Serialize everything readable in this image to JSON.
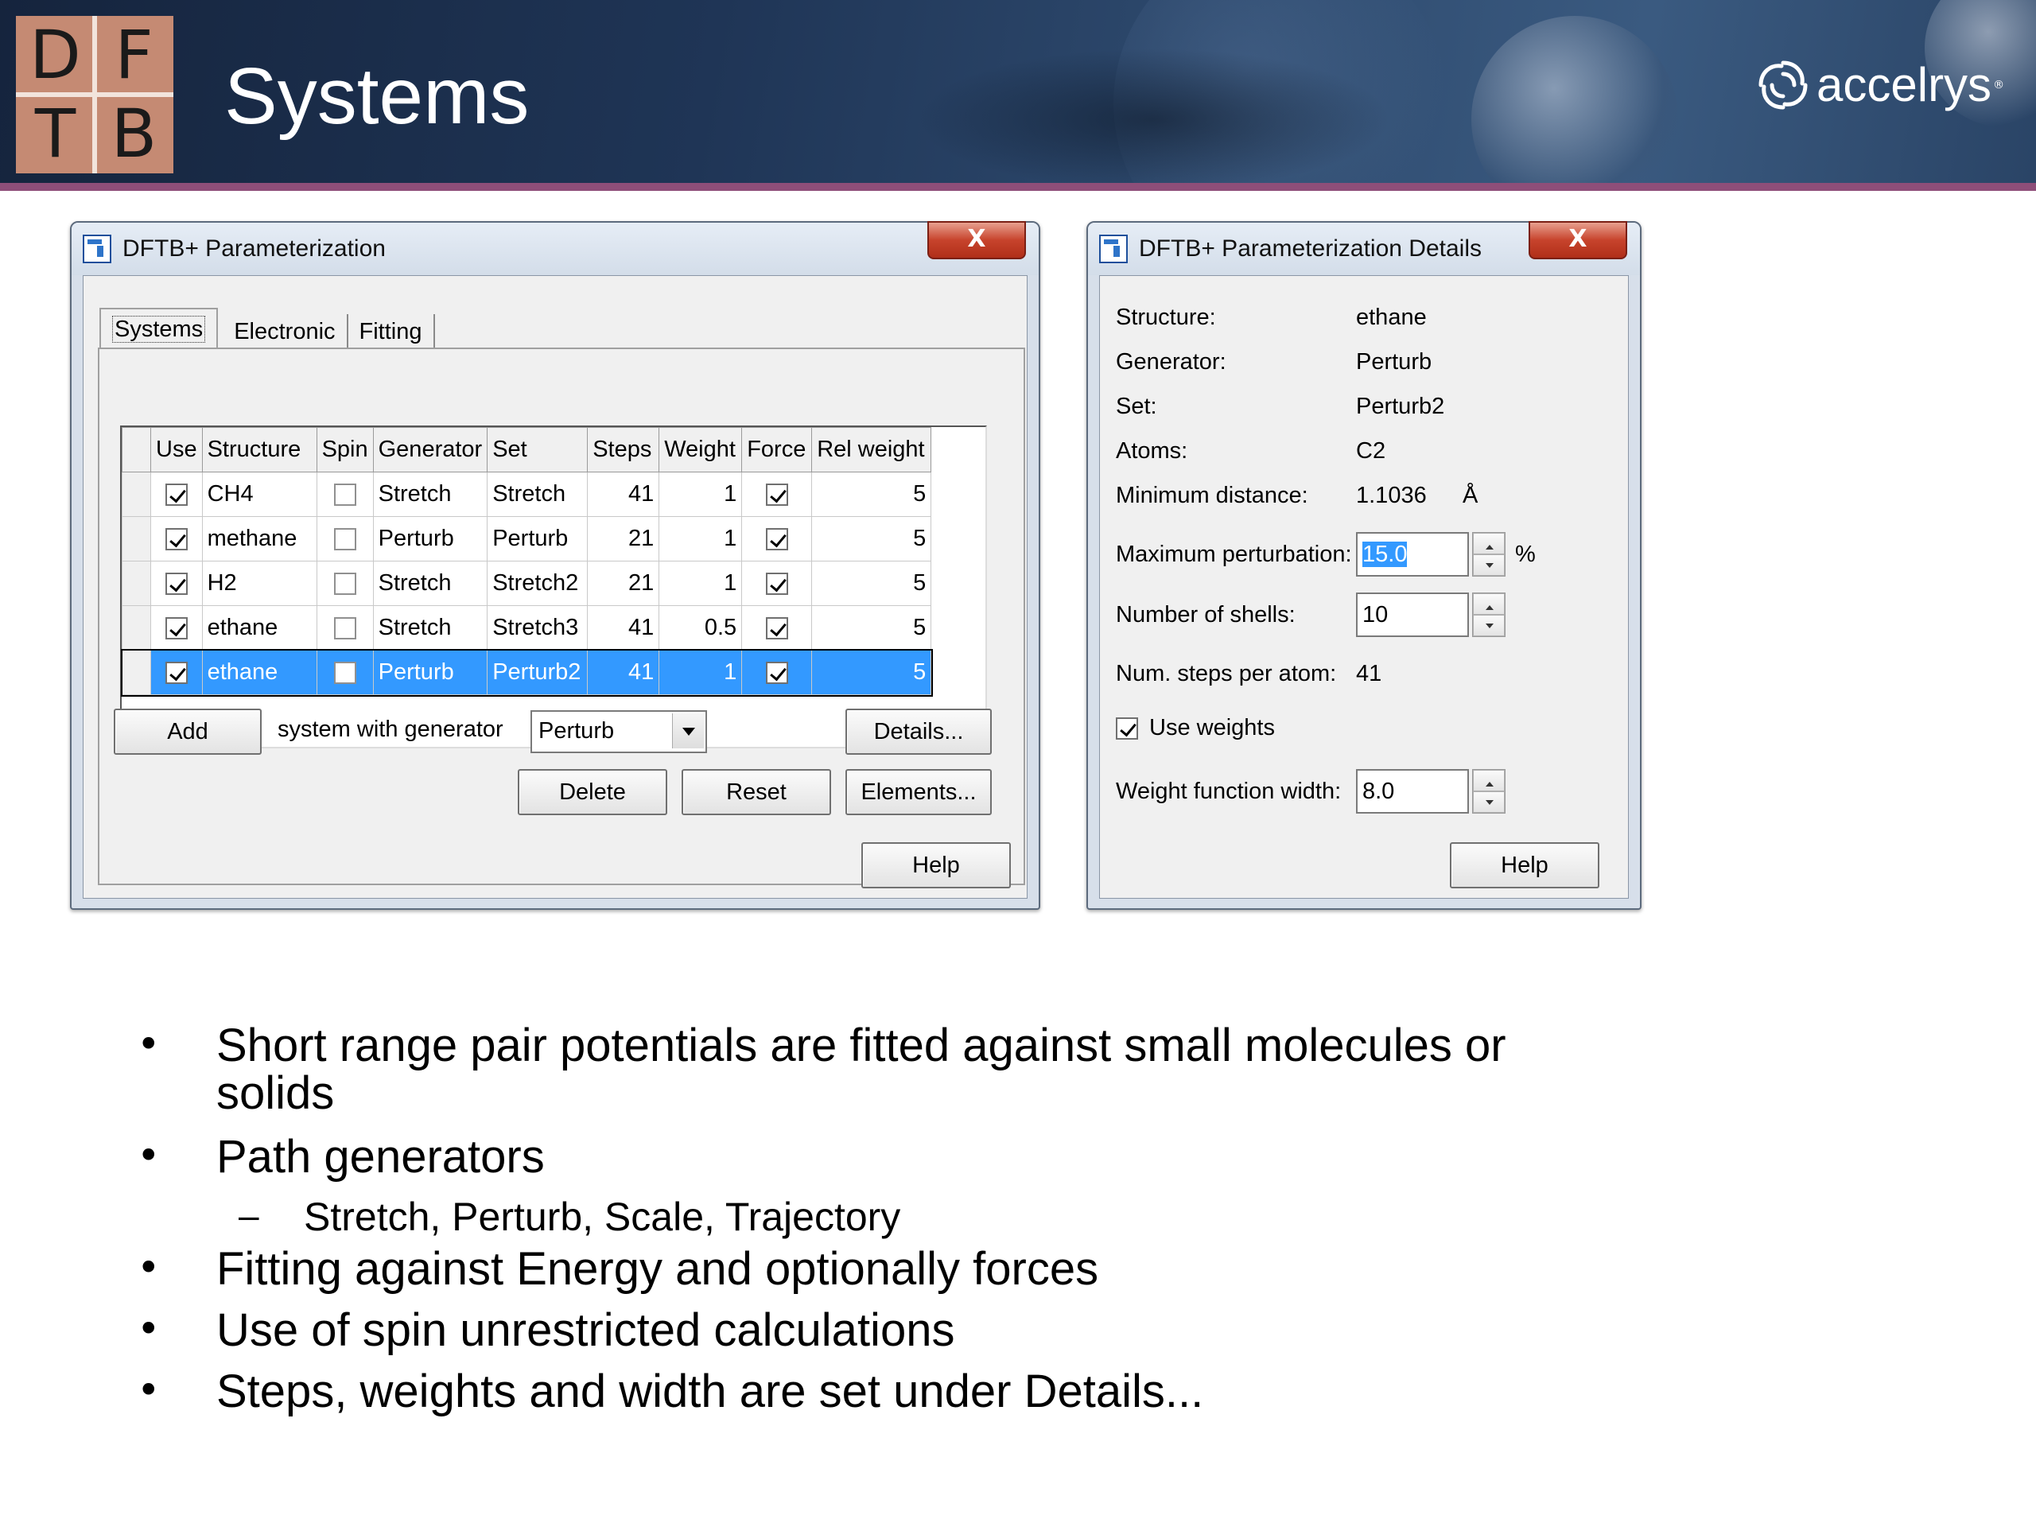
{
  "slide": {
    "title": "Systems",
    "logo_letters": [
      "D",
      "F",
      "T",
      "B"
    ],
    "brand": "accelrys",
    "brand_mark": "®"
  },
  "colors": {
    "header_bg": "#1f3556",
    "header_accent_line": "#8e4e79",
    "logo_bg": "#c58a73",
    "selection": "#3399ff"
  },
  "main_dialog": {
    "title": "DFTB+ Parameterization",
    "close_label": "X",
    "tabs": [
      {
        "label": "Systems",
        "active": true
      },
      {
        "label": "Electronic",
        "active": false
      },
      {
        "label": "Fitting",
        "active": false
      }
    ],
    "table": {
      "columns": [
        "Use",
        "Structure",
        "Spin",
        "Generator",
        "Set",
        "Steps",
        "Weight",
        "Force",
        "Rel weight"
      ],
      "rows": [
        {
          "use": true,
          "structure": "CH4",
          "spin": false,
          "generator": "Stretch",
          "set": "Stretch",
          "steps": "41",
          "weight": "1",
          "force": true,
          "rel_weight": "5",
          "selected": false
        },
        {
          "use": true,
          "structure": "methane",
          "spin": false,
          "generator": "Perturb",
          "set": "Perturb",
          "steps": "21",
          "weight": "1",
          "force": true,
          "rel_weight": "5",
          "selected": false
        },
        {
          "use": true,
          "structure": "H2",
          "spin": false,
          "generator": "Stretch",
          "set": "Stretch2",
          "steps": "21",
          "weight": "1",
          "force": true,
          "rel_weight": "5",
          "selected": false
        },
        {
          "use": true,
          "structure": "ethane",
          "spin": false,
          "generator": "Stretch",
          "set": "Stretch3",
          "steps": "41",
          "weight": "0.5",
          "force": true,
          "rel_weight": "5",
          "selected": false
        },
        {
          "use": true,
          "structure": "ethane",
          "spin": false,
          "generator": "Perturb",
          "set": "Perturb2",
          "steps": "41",
          "weight": "1",
          "force": true,
          "rel_weight": "5",
          "selected": true
        }
      ]
    },
    "add_label": "Add",
    "generator_text": "system with generator",
    "generator_value": "Perturb",
    "details_label": "Details...",
    "delete_label": "Delete",
    "reset_label": "Reset",
    "elements_label": "Elements...",
    "help_label": "Help"
  },
  "details_dialog": {
    "title": "DFTB+ Parameterization Details",
    "close_label": "X",
    "structure_label": "Structure:",
    "structure_value": "ethane",
    "generator_label": "Generator:",
    "generator_value": "Perturb",
    "set_label": "Set:",
    "set_value": "Perturb2",
    "atoms_label": "Atoms:",
    "atoms_value": "C2",
    "min_distance_label": "Minimum distance:",
    "min_distance_value": "1.1036",
    "min_distance_unit": "Å",
    "max_perturbation_label": "Maximum perturbation:",
    "max_perturbation_value": "15.0",
    "max_perturbation_unit": "%",
    "num_shells_label": "Number of shells:",
    "num_shells_value": "10",
    "steps_per_atom_label": "Num. steps per atom:",
    "steps_per_atom_value": "41",
    "use_weights_label": "Use weights",
    "use_weights_checked": true,
    "weight_width_label": "Weight function width:",
    "weight_width_value": "8.0",
    "help_label": "Help"
  },
  "bullets": [
    {
      "level": 1,
      "lines": [
        "Short range pair potentials are fitted against small molecules or",
        "solids"
      ]
    },
    {
      "level": 1,
      "lines": [
        "Path generators"
      ]
    },
    {
      "level": 2,
      "lines": [
        "Stretch, Perturb, Scale, Trajectory"
      ]
    },
    {
      "level": 1,
      "lines": [
        "Fitting against Energy and optionally forces"
      ]
    },
    {
      "level": 1,
      "lines": [
        "Use of spin unrestricted calculations"
      ]
    },
    {
      "level": 1,
      "lines": [
        "Steps, weights and width are set under Details..."
      ]
    }
  ]
}
